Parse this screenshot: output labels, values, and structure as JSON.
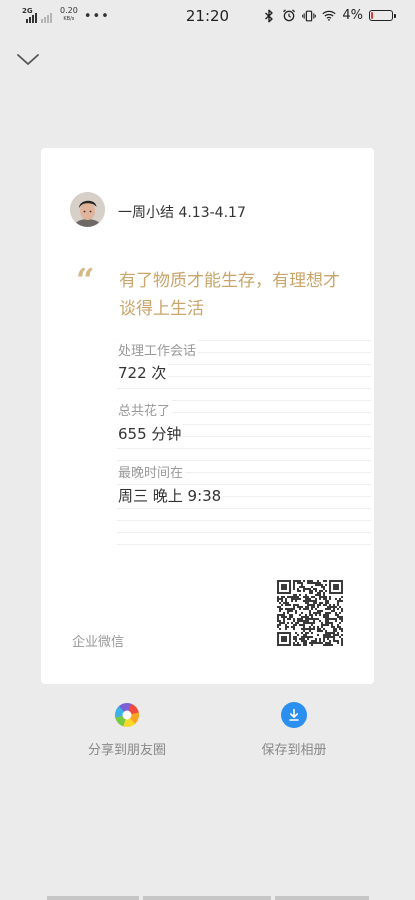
{
  "status_bar": {
    "network_type": "2G",
    "net_speed_value": "0.20",
    "net_speed_unit": "KB/s",
    "more_dots": "•••",
    "time": "21:20",
    "battery_percent": "4%",
    "battery_level": 0.04,
    "battery_color": "#e23a3a",
    "icons": [
      "bluetooth-icon",
      "alarm-icon",
      "vibrate-icon",
      "wifi-icon"
    ]
  },
  "header": {
    "collapse_icon": "chevron-down-icon"
  },
  "card": {
    "title": "一周小结 4.13-4.17",
    "quote_mark": "“",
    "quote": "有了物质才能生存，有理想才谈得上生活",
    "stats": [
      {
        "label": "处理工作会话",
        "value": "722 次"
      },
      {
        "label": "总共花了",
        "value": "655 分钟"
      },
      {
        "label": "最晚时间在",
        "value": "周三 晚上 9:38"
      }
    ],
    "brand": "企业微信",
    "accent_color": "#c9a56b"
  },
  "actions": {
    "share_label": "分享到朋友圈",
    "save_label": "保存到相册",
    "save_color": "#2b8ff0"
  }
}
